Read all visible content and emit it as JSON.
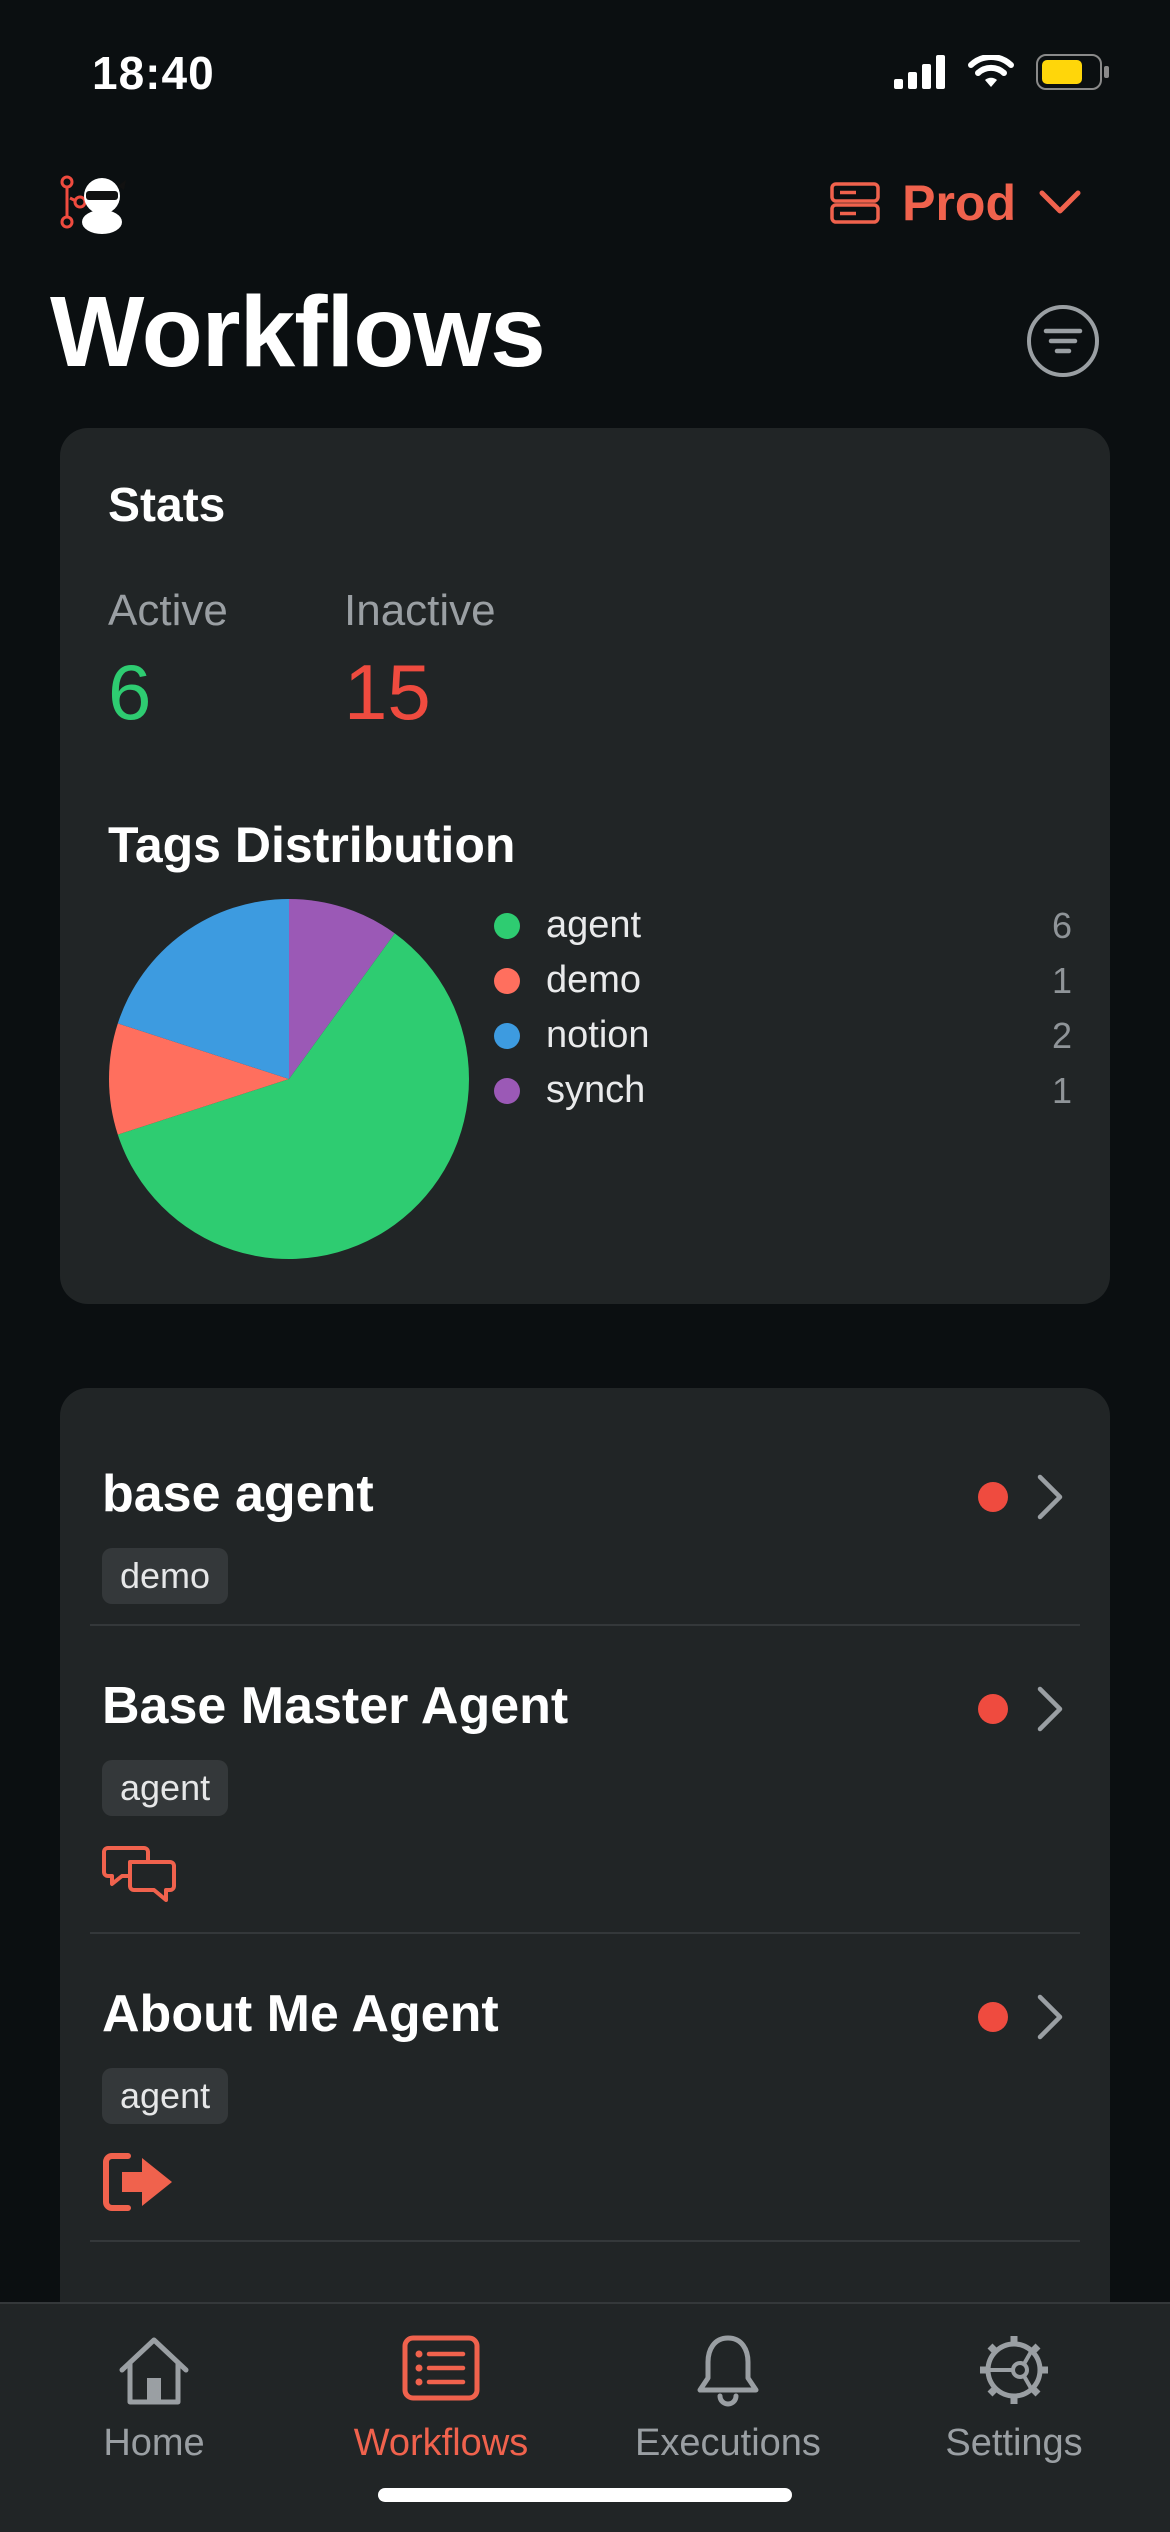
{
  "status_bar": {
    "time": "18:40",
    "icons": [
      "signal-icon",
      "wifi-icon",
      "battery-icon"
    ],
    "battery_color": "#ffd60a"
  },
  "header": {
    "logo_icon": "ninja-logo-icon",
    "environment": "Prod",
    "env_icon": "server-icon",
    "title": "Workflows",
    "filter_icon": "filter-icon"
  },
  "stats": {
    "title": "Stats",
    "active_label": "Active",
    "active_value": "6",
    "inactive_label": "Inactive",
    "inactive_value": "15",
    "colors": {
      "active": "#2ecc71",
      "inactive": "#ef4b3f"
    }
  },
  "tags_distribution": {
    "title": "Tags Distribution",
    "legend": [
      {
        "label": "agent",
        "count": "6",
        "color": "#2ecc71"
      },
      {
        "label": "demo",
        "count": "1",
        "color": "#ff6f5e"
      },
      {
        "label": "notion",
        "count": "2",
        "color": "#3d9be0"
      },
      {
        "label": "synch",
        "count": "1",
        "color": "#9b59b6"
      }
    ]
  },
  "chart_data": {
    "type": "pie",
    "categories": [
      "agent",
      "demo",
      "notion",
      "synch"
    ],
    "values": [
      6,
      1,
      2,
      1
    ],
    "colors": [
      "#2ecc71",
      "#ff6f5e",
      "#3d9be0",
      "#9b59b6"
    ],
    "title": "Tags Distribution"
  },
  "workflows": [
    {
      "name": "base agent",
      "tag": "demo",
      "status": "inactive",
      "trigger_icon": ""
    },
    {
      "name": "Base Master Agent",
      "tag": "agent",
      "status": "inactive",
      "trigger_icon": "chat-icon"
    },
    {
      "name": "About Me Agent",
      "tag": "agent",
      "status": "inactive",
      "trigger_icon": "exit-icon"
    }
  ],
  "tab_bar": {
    "tabs": [
      {
        "label": "Home",
        "icon": "home-icon",
        "active": false
      },
      {
        "label": "Workflows",
        "icon": "workflows-icon",
        "active": true
      },
      {
        "label": "Executions",
        "icon": "bell-icon",
        "active": false
      },
      {
        "label": "Settings",
        "icon": "gear-icon",
        "active": false
      }
    ],
    "accent": "#f0624d"
  }
}
